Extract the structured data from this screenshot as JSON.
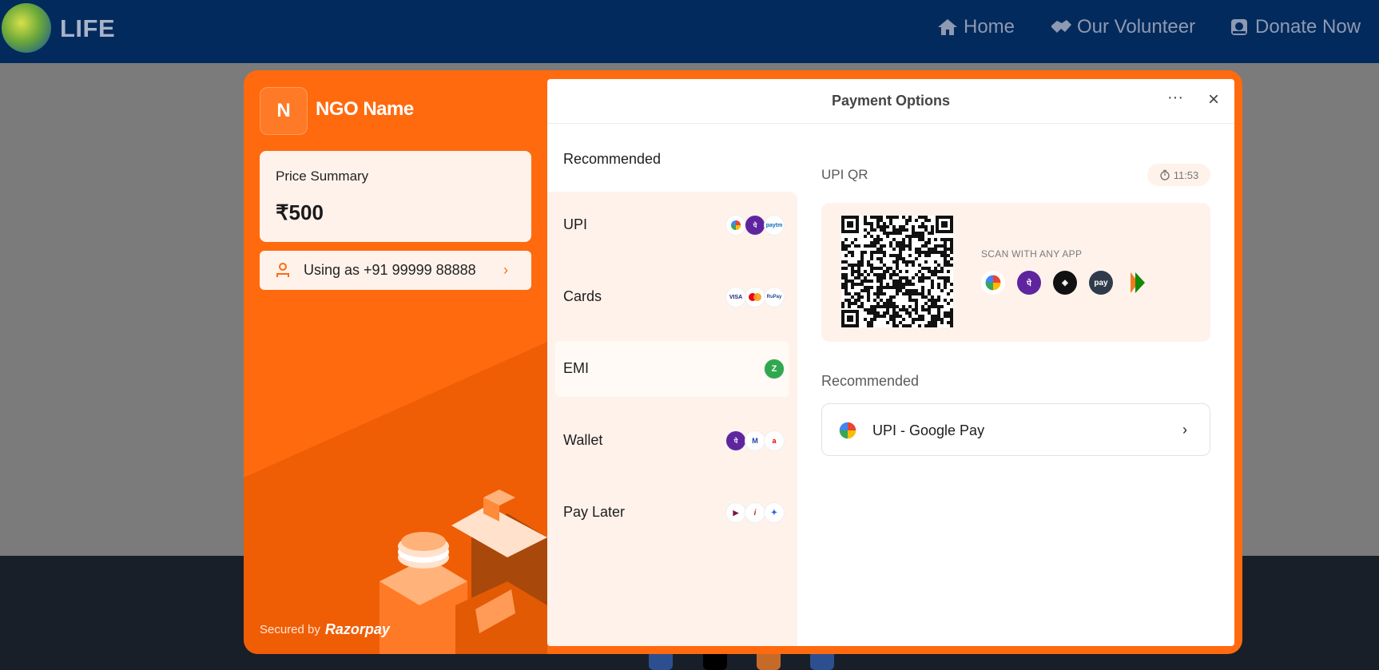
{
  "navbar": {
    "logo_text": "LIFE",
    "items": [
      {
        "label": "Home",
        "icon": "home-icon"
      },
      {
        "label": "Our Volunteer",
        "icon": "handshake-icon"
      },
      {
        "label": "Donate Now",
        "icon": "donate-icon"
      }
    ]
  },
  "checkout": {
    "brand_initial": "N",
    "brand_name": "NGO Name",
    "price_summary_label": "Price Summary",
    "price_value": "₹500",
    "user_text": "Using as +91 99999 88888",
    "secured_by": "Secured by",
    "razorpay": "Razorpay",
    "accent_color": "#ff6a0f"
  },
  "panel": {
    "title": "Payment Options",
    "methods_heading": "Recommended",
    "methods": [
      {
        "label": "UPI",
        "icons": [
          "gpay-icon",
          "phonepe-icon",
          "paytm-icon"
        ]
      },
      {
        "label": "Cards",
        "icons": [
          "visa-icon",
          "mastercard-icon",
          "rupay-icon"
        ]
      },
      {
        "label": "EMI",
        "icons": [
          "zest-icon"
        ]
      },
      {
        "label": "Wallet",
        "icons": [
          "phonepe-icon",
          "mobikwik-icon",
          "airtel-icon"
        ]
      },
      {
        "label": "Pay Later",
        "icons": [
          "lazypay-icon",
          "icici-icon",
          "simpl-icon"
        ]
      }
    ],
    "mi_text": {
      "paytm": "paytm",
      "visa": "VISA",
      "rupay": "RuPay"
    },
    "qr_heading": "UPI QR",
    "timer": "11:53",
    "scan_text": "SCAN WITH ANY APP",
    "scan_apps": [
      "gpay-icon",
      "phonepe-icon",
      "cred-icon",
      "amazonpay-icon",
      "bhim-icon"
    ],
    "recommended_heading": "Recommended",
    "recommended_option": "UPI - Google Pay"
  }
}
